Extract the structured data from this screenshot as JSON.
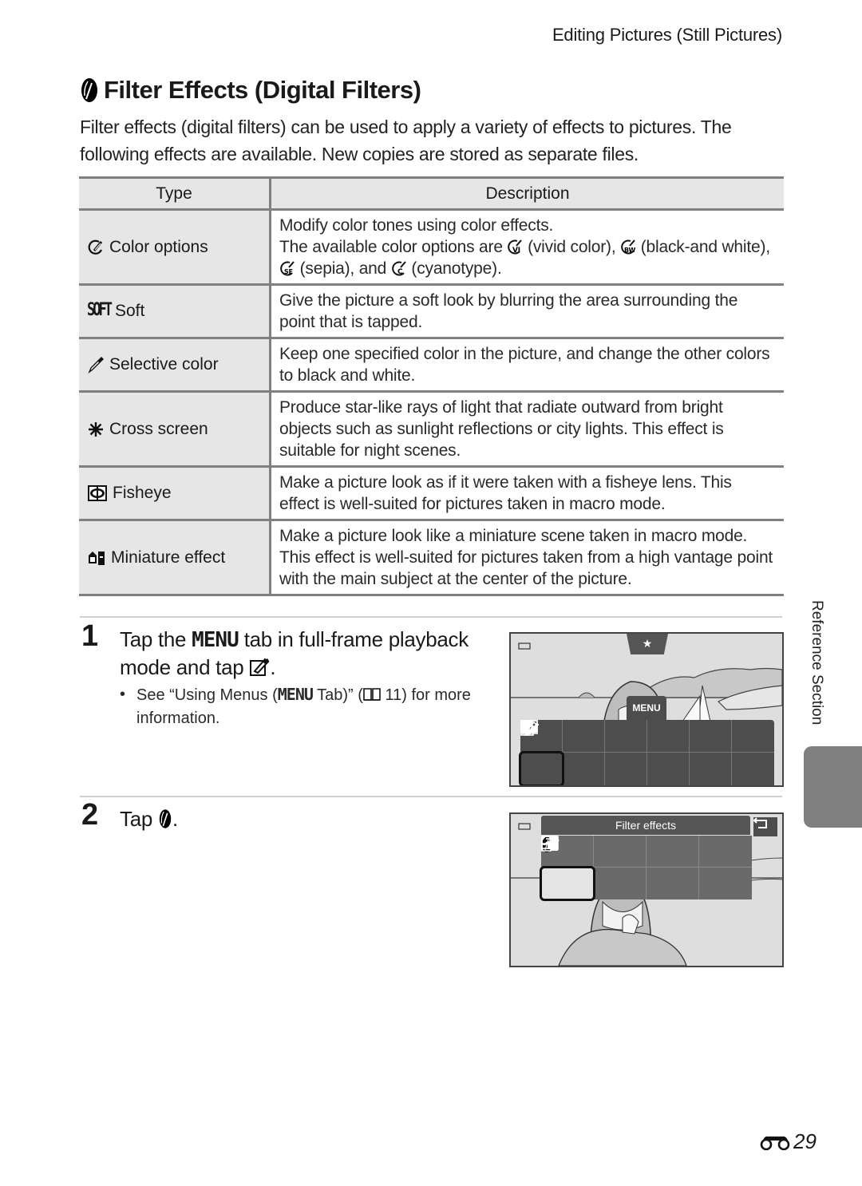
{
  "header": {
    "running_title": "Editing Pictures (Still Pictures)"
  },
  "section": {
    "title": "Filter Effects (Digital Filters)",
    "title_icon": "filter-effects-icon",
    "intro": "Filter effects (digital filters) can be used to apply a variety of effects to pictures. The following effects are available. New copies are stored as separate files."
  },
  "table": {
    "headers": [
      "Type",
      "Description"
    ],
    "rows": [
      {
        "icon": "color-options-icon",
        "type": "Color options",
        "desc_lines": [
          "Modify color tones using color effects."
        ],
        "desc_options": {
          "prefix": "The available color options are",
          "items": [
            {
              "icon": "vivid-color-icon",
              "badge": "VI",
              "label": "(vivid color),"
            },
            {
              "icon": "black-and-white-icon",
              "badge": "BW",
              "label": "(black-and white),"
            },
            {
              "icon": "sepia-icon",
              "badge": "SE",
              "label": "(sepia), and"
            },
            {
              "icon": "cyanotype-icon",
              "badge": "C",
              "label": "(cyanotype)."
            }
          ]
        }
      },
      {
        "icon": "soft-icon",
        "icon_text": "SOFT",
        "type": "Soft",
        "desc": "Give the picture a soft look by blurring the area surrounding the point that is tapped."
      },
      {
        "icon": "selective-color-icon",
        "type": "Selective color",
        "desc": "Keep one specified color in the picture, and change the other colors to black and white."
      },
      {
        "icon": "cross-screen-icon",
        "type": "Cross screen",
        "desc": "Produce star-like rays of light that radiate outward from bright objects such as sunlight reflections or city lights. This effect is suitable for night scenes."
      },
      {
        "icon": "fisheye-icon",
        "type": "Fisheye",
        "desc": "Make a picture look as if it were taken with a fisheye lens. This effect is well-suited for pictures taken in macro mode."
      },
      {
        "icon": "miniature-effect-icon",
        "type": "Miniature effect",
        "desc": "Make a picture look like a miniature scene taken in macro mode. This effect is well-suited for pictures taken from a high vantage point with the main subject at the center of the picture."
      }
    ]
  },
  "steps": [
    {
      "number": "1",
      "text_a": "Tap the",
      "menu_word": "MENU",
      "text_b": "tab in full-frame playback",
      "text_c": "mode and tap",
      "text_d": ".",
      "bullet": {
        "a": "See “Using Menus (",
        "menu_word": "MENU",
        "b": "Tab)” (",
        "page_ref": "11",
        "c": ") for more information."
      },
      "screen": {
        "menu_tab_label": "MENU",
        "favorite_tab": "★",
        "menu_icons_row1": [
          "favorites-icon",
          "delete-icon",
          "slideshow-icon",
          "protect-icon",
          "print-order-icon",
          "retouch-icon"
        ],
        "menu_icons_row2": [
          "edit-icon",
          "voice-memo-icon",
          "copy-icon",
          "",
          "",
          "setup-icon"
        ],
        "selected": "edit-icon"
      }
    },
    {
      "number": "2",
      "text_a": "Tap",
      "text_d": ".",
      "screen": {
        "panel_title": "Filter effects",
        "back_icon": "back-icon",
        "icons_row1": [
          "cross-screen-icon",
          "selective-color-icon",
          "fisheye-icon",
          "miniature-effect-icon"
        ],
        "icons_row2": [
          "filter-effects-icon",
          "paint-icon",
          "quick-retouch-icon",
          "small-picture-icon"
        ],
        "selected": "filter-effects-icon"
      }
    }
  ],
  "side_tab": {
    "label": "Reference Section"
  },
  "footer": {
    "page_number": "29",
    "page_prefix_icon": "binoculars-icon"
  }
}
